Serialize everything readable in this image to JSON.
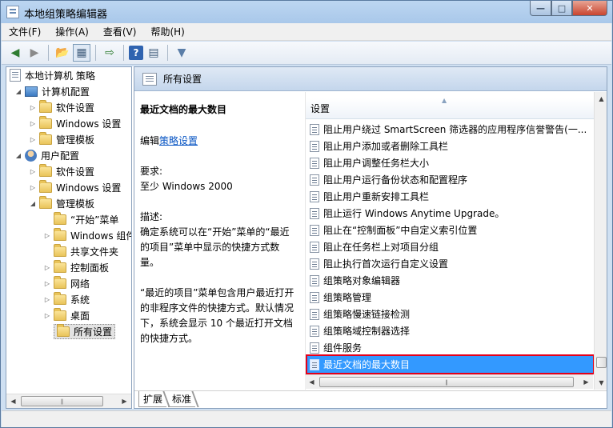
{
  "window": {
    "title": "本地组策略编辑器"
  },
  "menu": [
    "文件(F)",
    "操作(A)",
    "查看(V)",
    "帮助(H)"
  ],
  "toolbar_icons": [
    "back-icon",
    "forward-icon",
    "up-folder-icon",
    "show-tree-icon",
    "export-icon",
    "help-icon",
    "properties-icon",
    "filter-icon"
  ],
  "tree": {
    "root": "本地计算机 策略",
    "computer_config": "计算机配置",
    "software_settings_1": "软件设置",
    "windows_settings_1": "Windows 设置",
    "admin_templates_1": "管理模板",
    "user_config": "用户配置",
    "software_settings_2": "软件设置",
    "windows_settings_2": "Windows 设置",
    "admin_templates_2": "管理模板",
    "start_menu": "“开始”菜单",
    "windows_components": "Windows 组件",
    "shared_folders": "共享文件夹",
    "control_panel": "控制面板",
    "network": "网络",
    "system": "系统",
    "desktop": "桌面",
    "all_settings": "所有设置"
  },
  "right_header": {
    "title": "所有设置"
  },
  "description": {
    "title": "最近文档的最大数目",
    "edit_prefix": "编辑",
    "edit_link": "策略设置",
    "requirements_label": "要求:",
    "requirements_value": "至少 Windows 2000",
    "desc_label": "描述:",
    "desc_para1": "确定系统可以在“开始”菜单的“最近的项目”菜单中显示的快捷方式数量。",
    "desc_para2": "“最近的项目”菜单包含用户最近打开的非程序文件的快捷方式。默认情况下，系统会显示 10 个最近打开文档的快捷方式。"
  },
  "list": {
    "column_header": "设置",
    "items": [
      "阻止用户绕过 SmartScreen 筛选器的应用程序信誉警告(一...",
      "阻止用户添加或者删除工具栏",
      "阻止用户调整任务栏大小",
      "阻止用户运行备份状态和配置程序",
      "阻止用户重新安排工具栏",
      "阻止运行 Windows Anytime Upgrade。",
      "阻止在“控制面板”中自定义索引位置",
      "阻止在任务栏上对项目分组",
      "阻止执行首次运行自定义设置",
      "组策略对象编辑器",
      "组策略管理",
      "组策略慢速链接检测",
      "组策略域控制器选择",
      "组件服务",
      "最近文档的最大数目"
    ],
    "selected_index": 14
  },
  "tabs": [
    "扩展",
    "标准"
  ],
  "scroll": {
    "list_vertical_position": 0.97
  }
}
